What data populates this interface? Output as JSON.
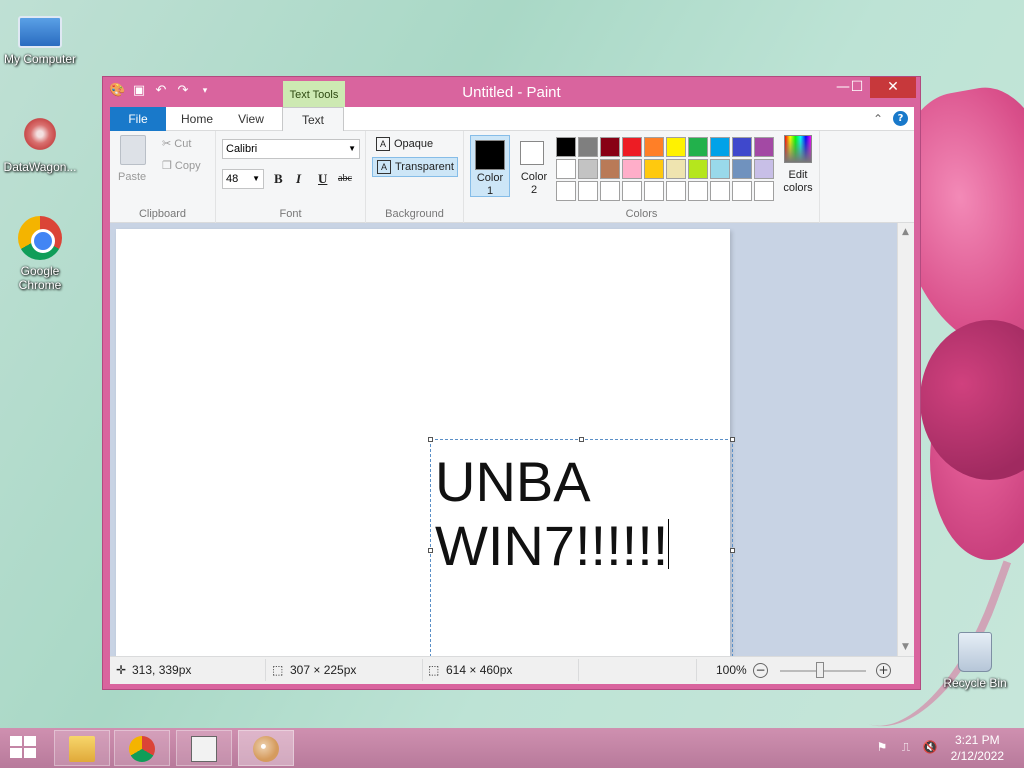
{
  "desktop": {
    "icons": [
      {
        "label": "My Computer"
      },
      {
        "label": "DataWagon..."
      },
      {
        "label": "Google Chrome"
      },
      {
        "label": "Recycle Bin"
      }
    ]
  },
  "window": {
    "title": "Untitled - Paint",
    "context_tab": "Text Tools",
    "tabs": {
      "file": "File",
      "home": "Home",
      "view": "View",
      "text": "Text"
    }
  },
  "ribbon": {
    "clipboard": {
      "paste": "Paste",
      "cut": "Cut",
      "copy": "Copy",
      "label": "Clipboard"
    },
    "font": {
      "family": "Calibri",
      "size": "48",
      "bold": "B",
      "italic": "I",
      "underline": "U",
      "strike": "abc",
      "label": "Font"
    },
    "background": {
      "opaque": "Opaque",
      "transparent": "Transparent",
      "label": "Background",
      "selected": "Transparent"
    },
    "colors": {
      "color1_label": "Color\n1",
      "color2_label": "Color\n2",
      "color1": "#000000",
      "color2": "#ffffff",
      "edit_label": "Edit\ncolors",
      "label": "Colors",
      "palette": [
        "#000000",
        "#7f7f7f",
        "#880015",
        "#ed1c24",
        "#ff7f27",
        "#fff200",
        "#22b14c",
        "#00a2e8",
        "#3f48cc",
        "#a349a4",
        "#ffffff",
        "#c3c3c3",
        "#b97a57",
        "#ffaec9",
        "#ffc90e",
        "#efe4b0",
        "#b5e61d",
        "#99d9ea",
        "#7092be",
        "#c8bfe7",
        "#ffffff",
        "#ffffff",
        "#ffffff",
        "#ffffff",
        "#ffffff",
        "#ffffff",
        "#ffffff",
        "#ffffff",
        "#ffffff",
        "#ffffff"
      ]
    }
  },
  "canvas": {
    "text_line1": "UNBA",
    "text_line2": "WIN7!!!!!!"
  },
  "status": {
    "cursor_pos": "313, 339px",
    "selection_size": "307 × 225px",
    "image_size": "614 × 460px",
    "zoom": "100%"
  },
  "taskbar": {
    "time": "3:21 PM",
    "date": "2/12/2022"
  }
}
